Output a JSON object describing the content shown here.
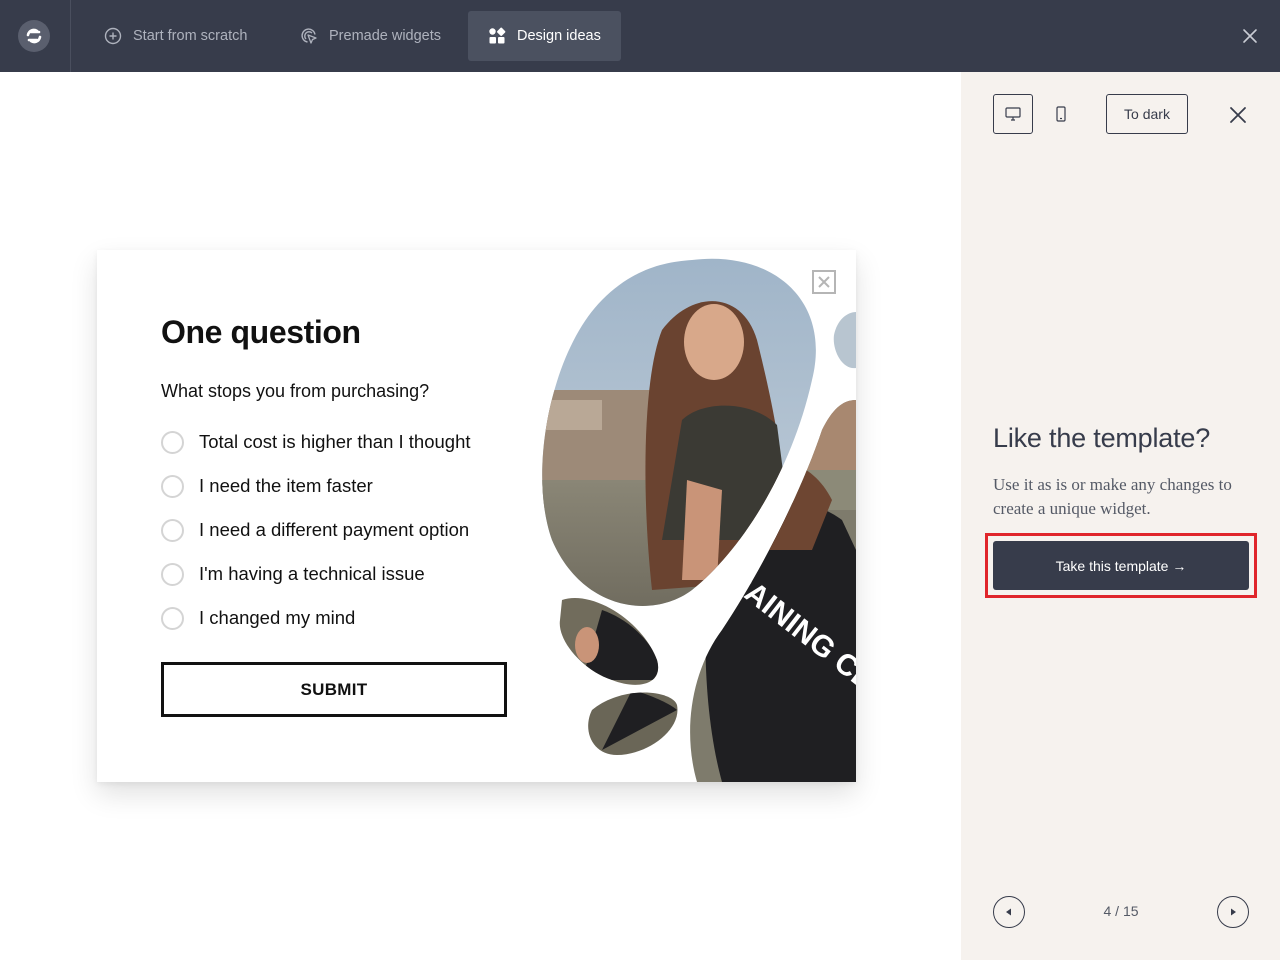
{
  "topbar": {
    "tabs": [
      {
        "label": "Start from scratch",
        "icon": "plus-circle-icon",
        "active": false
      },
      {
        "label": "Premade widgets",
        "icon": "cursor-target-icon",
        "active": false
      },
      {
        "label": "Design ideas",
        "icon": "widgets-grid-icon",
        "active": true
      }
    ]
  },
  "panel": {
    "to_dark_label": "To dark",
    "title": "Like the template?",
    "description": "Use it as is or make any changes to create a unique widget.",
    "take_button_label": "Take this template →",
    "pager": "4 / 15"
  },
  "widget": {
    "title": "One question",
    "question": "What stops you from purchasing?",
    "options": [
      "Total cost is higher than I thought",
      "I need the item faster",
      "I need a different payment option",
      "I'm having a technical issue",
      "I changed my mind"
    ],
    "submit_label": "SUBMIT",
    "image_text": "RAINING CLUB"
  },
  "colors": {
    "topbar_bg": "#373c4b",
    "panel_bg": "#f6f2ee",
    "primary_button": "#373c4b",
    "highlight_outline": "#e0262b"
  }
}
